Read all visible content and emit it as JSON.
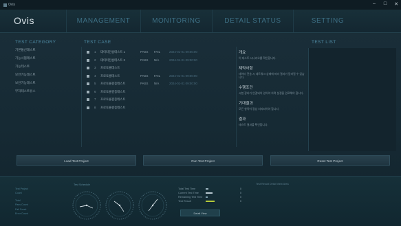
{
  "window": {
    "title": "Ovis",
    "controls": {
      "minimize": "–",
      "maximize": "□",
      "close": "✕"
    }
  },
  "nav": {
    "brand": "Ovis",
    "items": [
      "MANAGEMENT",
      "MONITORING",
      "DETAIL STATUS",
      "SETTING"
    ]
  },
  "sections": {
    "category": "TEST CATEGORY",
    "case": "TEST CASE",
    "list": "TEST LIST"
  },
  "categories": [
    "기본통신테스트",
    "기능시험테스트",
    "기능테스트",
    "보안기능테스트",
    "보안기능테스트",
    "부하테스트유스"
  ],
  "test_cases": [
    {
      "index": "1",
      "name": "데이터전송테스트 1",
      "col1": "PASS",
      "col2": "FAIL",
      "col3": "2024-01-01 09:00:00"
    },
    {
      "index": "2",
      "name": "데이터전송테스트 2",
      "col1": "PASS",
      "col2": "N/A",
      "col3": "2024-01-01 09:00:00"
    },
    {
      "index": "3",
      "name": "프로토콜테스트",
      "col1": "",
      "col2": "",
      "col3": ""
    },
    {
      "index": "4",
      "name": "프로토콜테스트",
      "col1": "PASS",
      "col2": "FAIL",
      "col3": "2024-01-01 09:00:00"
    },
    {
      "index": "5",
      "name": "프로토콜검증테스트",
      "col1": "PASS",
      "col2": "N/A",
      "col3": "2024-01-01 09:00:00"
    },
    {
      "index": "6",
      "name": "프로토콜검증테스트",
      "col1": "",
      "col2": "",
      "col3": ""
    },
    {
      "index": "7",
      "name": "프로토콜검증테스트",
      "col1": "",
      "col2": "",
      "col3": ""
    },
    {
      "index": "8",
      "name": "프로토콜검증테스트",
      "col1": "",
      "col2": "",
      "col3": ""
    }
  ],
  "descriptions": [
    {
      "title": "개요",
      "body": "이 테스트 시나리오를 확인합니다."
    },
    {
      "title": "제약사항",
      "body": "데이터 전송 시 네트워크 상태에 따라 결과가 달라질 수 있습니다."
    },
    {
      "title": "수행조건",
      "body": "시험 장비가 연결되어 있어야 하며 설정을 완료해야 합니다."
    },
    {
      "title": "기대결과",
      "body": "모든 항목이 정상 처리되어야 합니다."
    },
    {
      "title": "결과",
      "body": "테스트 결과를 확인합니다."
    }
  ],
  "buttons": {
    "load": "Load Test Project",
    "run": "Run Test Project",
    "reset": "Reset Test Project"
  },
  "bottom": {
    "stats": [
      "Test Project",
      "Count",
      "",
      "Total",
      "Pass Count",
      "Fail Count",
      "Error Count"
    ],
    "gauges_label": "Test Schedule",
    "legend": [
      {
        "label": "Total Test Time",
        "value": "0",
        "color": "#9fb7c2",
        "fraction": 0.3
      },
      {
        "label": "Current Test Time",
        "value": "0",
        "color": "#b9c9d1",
        "fraction": 0.7
      },
      {
        "label": "Remaining Test Time",
        "value": "0",
        "color": "#7fa0ae",
        "fraction": 0.2
      },
      {
        "label": "Test Result",
        "value": "0",
        "color": "#b5c93a",
        "fraction": 0.9
      }
    ],
    "detail_button": "Detail View",
    "right_label": "Test Result Detail View Area"
  }
}
